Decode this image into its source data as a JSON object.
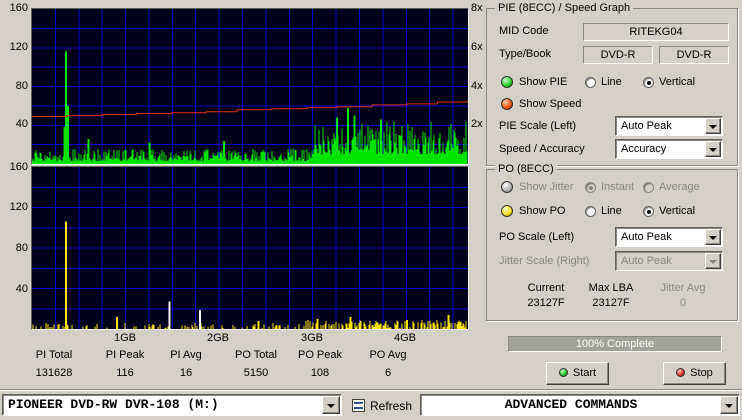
{
  "graph": {
    "pie_left_ticks": [
      "160",
      "120",
      "80",
      "40"
    ],
    "po_left_ticks": [
      "160",
      "120",
      "80",
      "40"
    ],
    "speed_right_ticks": [
      "8x",
      "6x",
      "4x",
      "2x"
    ],
    "x_ticks": [
      "1GB",
      "2GB",
      "3GB",
      "4GB"
    ]
  },
  "chart_data": [
    {
      "type": "area",
      "title": "PIE (8ECC) / Speed Graph",
      "ylim": [
        0,
        160
      ],
      "x_range_gb": [
        0,
        4.66
      ],
      "x_tick_labels": [
        "1GB",
        "2GB",
        "3GB",
        "4GB"
      ],
      "y_tick_labels_left": [
        "160",
        "120",
        "80",
        "40"
      ],
      "y_tick_labels_right": [
        "8x",
        "6x",
        "4x",
        "2x"
      ],
      "grid": true,
      "background": "#00001a",
      "grid_color": "#0000c8",
      "series": [
        {
          "name": "PIE errors",
          "render": "spikes",
          "color": "#00e400",
          "summary": {
            "total": 131628,
            "peak": 116,
            "avg": 16
          },
          "noise": {
            "seed": 7,
            "base_min": 3,
            "base_max": 16,
            "elevated_from": 0.645,
            "elevated_min": 10,
            "elevated_max": 44
          },
          "spikes": [
            {
              "x": 0.074,
              "v": 38
            },
            {
              "x": 0.078,
              "v": 116
            },
            {
              "x": 0.082,
              "v": 60
            },
            {
              "x": 0.13,
              "v": 26
            },
            {
              "x": 0.27,
              "v": 22
            },
            {
              "x": 0.44,
              "v": 24
            },
            {
              "x": 0.7,
              "v": 48
            },
            {
              "x": 0.725,
              "v": 58
            },
            {
              "x": 0.74,
              "v": 50
            },
            {
              "x": 0.8,
              "v": 46
            }
          ]
        },
        {
          "name": "Speed",
          "render": "stepline",
          "color": "#e03010",
          "unit": "x",
          "axis_max": 8,
          "points": [
            [
              0,
              2.45
            ],
            [
              0.08,
              2.5
            ],
            [
              0.16,
              2.55
            ],
            [
              0.24,
              2.6
            ],
            [
              0.32,
              2.65
            ],
            [
              0.4,
              2.7
            ],
            [
              0.47,
              2.8
            ],
            [
              0.55,
              2.85
            ],
            [
              0.63,
              2.9
            ],
            [
              0.7,
              2.95
            ],
            [
              0.78,
              3.05
            ],
            [
              0.86,
              3.1
            ],
            [
              0.93,
              3.2
            ],
            [
              1,
              3.3
            ]
          ]
        }
      ]
    },
    {
      "type": "bar",
      "title": "PO (8ECC)",
      "ylim": [
        0,
        160
      ],
      "y_tick_labels_left": [
        "160",
        "120",
        "80",
        "40"
      ],
      "grid": true,
      "background": "#00001a",
      "grid_color": "#0000c8",
      "series": [
        {
          "name": "PO errors",
          "render": "sparse-spikes",
          "color": "#ffe400",
          "summary": {
            "total": 5150,
            "peak": 108,
            "avg": 6
          },
          "noise": {
            "seed": 13,
            "density": 0.3,
            "max": 5,
            "elevated_from": 0.62,
            "elevated_density": 0.55,
            "elevated_max": 8
          },
          "spikes": [
            {
              "x": 0.078,
              "v": 106
            },
            {
              "x": 0.195,
              "v": 12
            },
            {
              "x": 0.315,
              "v": 27,
              "color": "#f4f4f4"
            },
            {
              "x": 0.385,
              "v": 19,
              "color": "#f4f4f4"
            },
            {
              "x": 0.52,
              "v": 8
            },
            {
              "x": 0.655,
              "v": 10
            },
            {
              "x": 0.73,
              "v": 12
            },
            {
              "x": 0.86,
              "v": 9
            },
            {
              "x": 0.955,
              "v": 14
            }
          ]
        }
      ]
    }
  ],
  "stats": {
    "items": [
      {
        "label": "PI Total",
        "value": "131628"
      },
      {
        "label": "PI Peak",
        "value": "116"
      },
      {
        "label": "PI Avg",
        "value": "16"
      },
      {
        "label": "PO Total",
        "value": "5150"
      },
      {
        "label": "PO Peak",
        "value": "108"
      },
      {
        "label": "PO Avg",
        "value": "6"
      }
    ]
  },
  "pie_panel": {
    "title": "PIE (8ECC) / Speed Graph",
    "mid_code_label": "MID Code",
    "mid_code_value": "RITEKG04",
    "type_book_label": "Type/Book",
    "type_value_1": "DVD-R",
    "type_value_2": "DVD-R",
    "show_pie_label": "Show PIE",
    "line_label": "Line",
    "vertical_label": "Vertical",
    "show_speed_label": "Show Speed",
    "pie_scale_label": "PIE Scale (Left)",
    "pie_scale_value": "Auto Peak",
    "speed_accuracy_label": "Speed / Accuracy",
    "speed_accuracy_value": "Accuracy"
  },
  "po_panel": {
    "title": "PO (8ECC)",
    "show_jitter_label": "Show Jitter",
    "instant_label": "Instant",
    "average_label": "Average",
    "show_po_label": "Show PO",
    "line_label": "Line",
    "vertical_label": "Vertical",
    "po_scale_label": "PO Scale (Left)",
    "po_scale_value": "Auto Peak",
    "jitter_scale_label": "Jitter Scale (Right)",
    "jitter_scale_value": "Auto Peak",
    "current_label": "Current",
    "current_value": "23127F",
    "max_lba_label": "Max LBA",
    "max_lba_value": "23127F",
    "jitter_avg_label": "Jitter Avg",
    "jitter_avg_value": "0"
  },
  "progress": {
    "label": "100% Complete"
  },
  "actions": {
    "start_label": "Start",
    "stop_label": "Stop"
  },
  "bottom_bar": {
    "drive_value": "PIONEER DVD-RW  DVR-108  (M:)",
    "refresh_label": "Refresh",
    "advanced_value": "ADVANCED COMMANDS"
  }
}
